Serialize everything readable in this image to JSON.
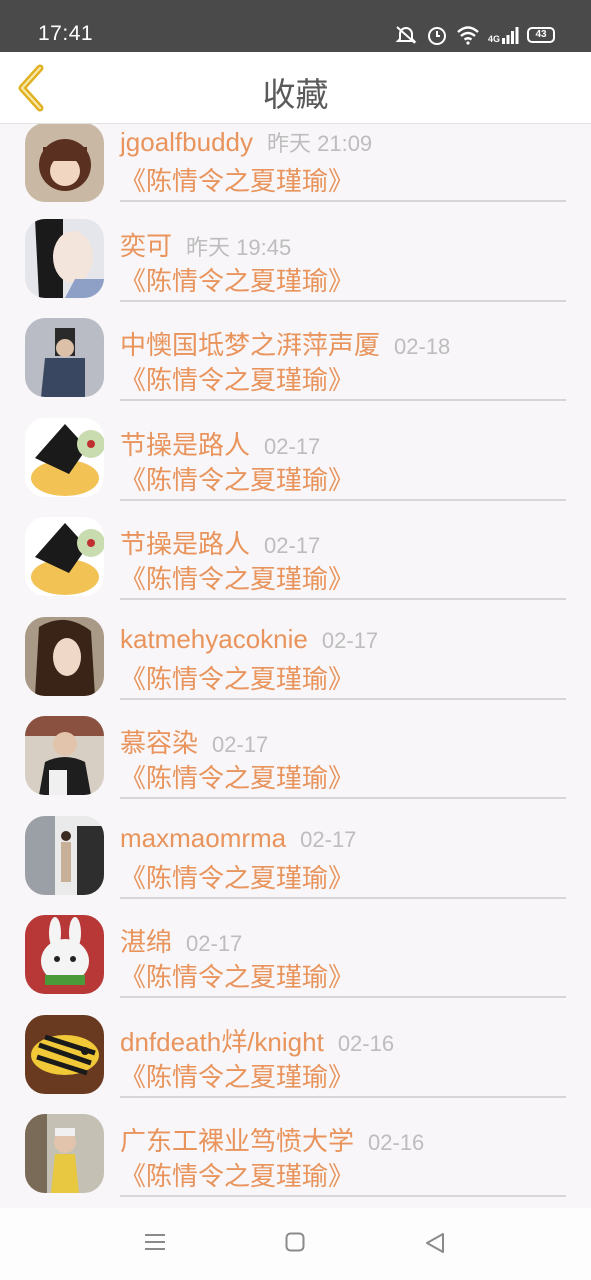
{
  "status_bar": {
    "time": "17:41",
    "network": "4G",
    "battery": "43"
  },
  "header": {
    "title": "收藏"
  },
  "items": [
    {
      "user": "jgoalfbuddy",
      "time": "昨天 21:09",
      "book": "《陈情令之夏瑾瑜》"
    },
    {
      "user": "奕可",
      "time": "昨天 19:45",
      "book": "《陈情令之夏瑾瑜》"
    },
    {
      "user": "中懊国坻梦之湃萍声厦",
      "time": "02-18",
      "book": "《陈情令之夏瑾瑜》"
    },
    {
      "user": "节操是路人",
      "time": "02-17",
      "book": "《陈情令之夏瑾瑜》"
    },
    {
      "user": "节操是路人",
      "time": "02-17",
      "book": "《陈情令之夏瑾瑜》"
    },
    {
      "user": "katmehyacoknie",
      "time": "02-17",
      "book": "《陈情令之夏瑾瑜》"
    },
    {
      "user": "慕容染",
      "time": "02-17",
      "book": "《陈情令之夏瑾瑜》"
    },
    {
      "user": "maxmaomrma",
      "time": "02-17",
      "book": "《陈情令之夏瑾瑜》"
    },
    {
      "user": "湛绵",
      "time": "02-17",
      "book": "《陈情令之夏瑾瑜》"
    },
    {
      "user": "dnfdeath烊/knight",
      "time": "02-16",
      "book": "《陈情令之夏瑾瑜》"
    },
    {
      "user": "广东工裸业笃愤大学",
      "time": "02-16",
      "book": "《陈情令之夏瑾瑜》"
    }
  ],
  "colors": {
    "accent": "#e8945c",
    "status_bar": "#4a4a4a",
    "back_arrow": "#e0b020"
  }
}
